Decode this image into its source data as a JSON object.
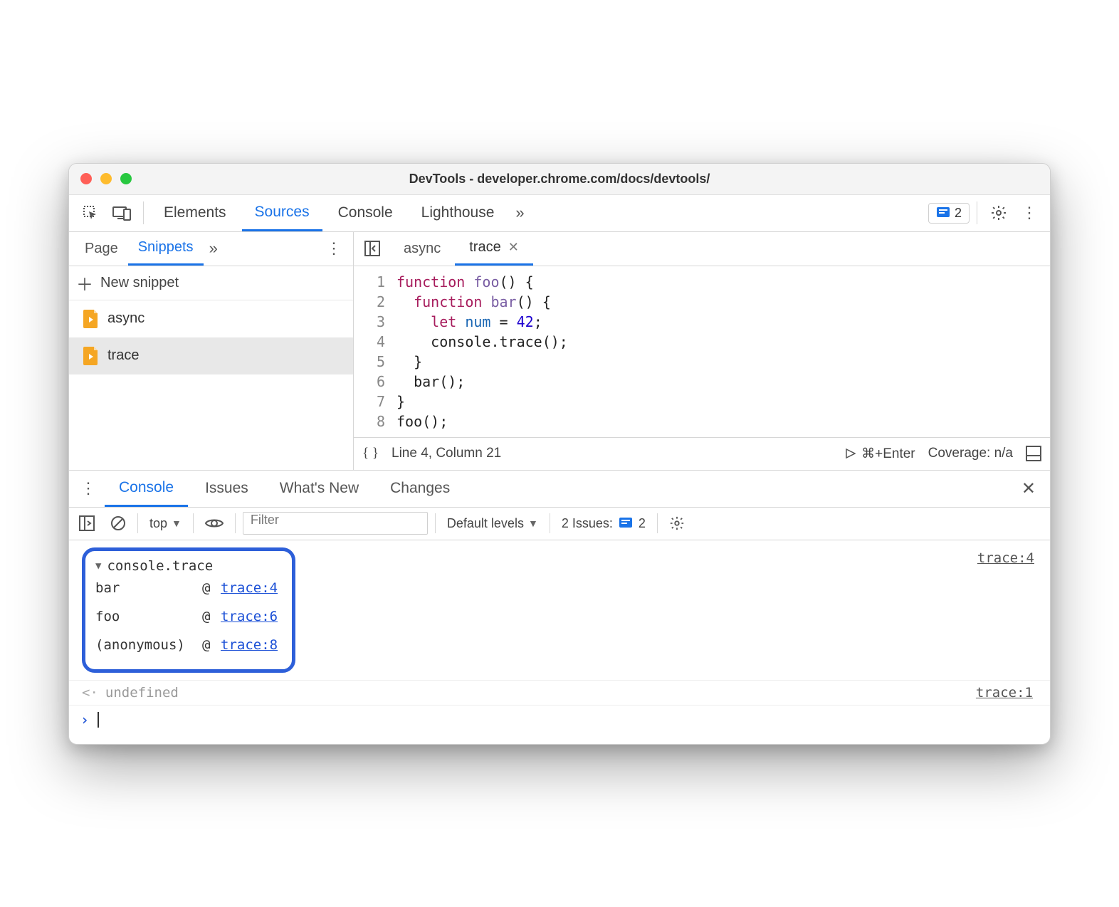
{
  "window": {
    "title": "DevTools - developer.chrome.com/docs/devtools/"
  },
  "toolbar": {
    "tabs": [
      "Elements",
      "Sources",
      "Console",
      "Lighthouse"
    ],
    "active": "Sources",
    "issues_count": "2"
  },
  "left_panel": {
    "tabs": [
      "Page",
      "Snippets"
    ],
    "active": "Snippets",
    "new_label": "New snippet",
    "snippets": [
      {
        "name": "async",
        "selected": false
      },
      {
        "name": "trace",
        "selected": true
      }
    ]
  },
  "editor": {
    "tabs": [
      {
        "name": "async",
        "active": false,
        "closeable": false
      },
      {
        "name": "trace",
        "active": true,
        "closeable": true
      }
    ],
    "lines": [
      1,
      2,
      3,
      4,
      5,
      6,
      7,
      8
    ],
    "code_tokens": [
      [
        {
          "t": "kw",
          "v": "function"
        },
        {
          "t": "",
          "v": " "
        },
        {
          "t": "fn",
          "v": "foo"
        },
        {
          "t": "",
          "v": "() {"
        }
      ],
      [
        {
          "t": "",
          "v": "  "
        },
        {
          "t": "kw",
          "v": "function"
        },
        {
          "t": "",
          "v": " "
        },
        {
          "t": "fn",
          "v": "bar"
        },
        {
          "t": "",
          "v": "() {"
        }
      ],
      [
        {
          "t": "",
          "v": "    "
        },
        {
          "t": "let",
          "v": "let"
        },
        {
          "t": "",
          "v": " "
        },
        {
          "t": "id",
          "v": "num"
        },
        {
          "t": "",
          "v": " = "
        },
        {
          "t": "num",
          "v": "42"
        },
        {
          "t": "",
          "v": ";"
        }
      ],
      [
        {
          "t": "",
          "v": "    console.trace();"
        }
      ],
      [
        {
          "t": "",
          "v": "  }"
        }
      ],
      [
        {
          "t": "",
          "v": "  bar();"
        }
      ],
      [
        {
          "t": "",
          "v": "}"
        }
      ],
      [
        {
          "t": "",
          "v": "foo();"
        }
      ]
    ],
    "status": {
      "pos": "Line 4, Column 21",
      "run_hint": "⌘+Enter",
      "coverage": "Coverage: n/a"
    }
  },
  "drawer": {
    "tabs": [
      "Console",
      "Issues",
      "What's New",
      "Changes"
    ],
    "active": "Console",
    "toolbar": {
      "context": "top",
      "filter_placeholder": "Filter",
      "levels": "Default levels",
      "issues_label": "2 Issues:",
      "issues_count": "2"
    },
    "console": {
      "trace_label": "console.trace",
      "src_link_top": "trace:4",
      "stack": [
        {
          "fn": "bar",
          "loc": "trace:4"
        },
        {
          "fn": "foo",
          "loc": "trace:6"
        },
        {
          "fn": "(anonymous)",
          "loc": "trace:8"
        }
      ],
      "undefined_label": "undefined",
      "undefined_src": "trace:1"
    }
  }
}
